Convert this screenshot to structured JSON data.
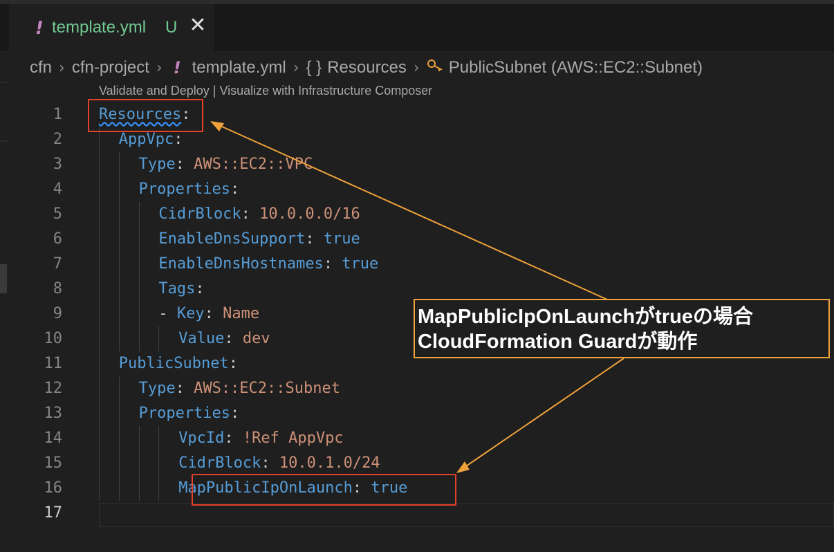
{
  "tab": {
    "icon": "yaml-exclamation-icon",
    "title": "template.yml",
    "status": "U",
    "close": "✕"
  },
  "breadcrumb": {
    "items": [
      "cfn",
      "cfn-project",
      "template.yml",
      "Resources",
      "PublicSubnet (AWS::EC2::Subnet)"
    ],
    "braces": "{ }",
    "exclamation": "!",
    "separator": "›"
  },
  "codelens": "Validate and Deploy | Visualize with Infrastructure Composer",
  "lines": [
    {
      "n": "1",
      "indent": 0,
      "key": "Resources",
      "colon": ":",
      "value": "",
      "vtype": ""
    },
    {
      "n": "2",
      "indent": 2,
      "key": "AppVpc",
      "colon": ":",
      "value": "",
      "vtype": ""
    },
    {
      "n": "3",
      "indent": 4,
      "key": "Type",
      "colon": ":",
      "value": "AWS::EC2::VPC",
      "vtype": "s"
    },
    {
      "n": "4",
      "indent": 4,
      "key": "Properties",
      "colon": ":",
      "value": "",
      "vtype": ""
    },
    {
      "n": "5",
      "indent": 6,
      "key": "CidrBlock",
      "colon": ":",
      "value": "10.0.0.0/16",
      "vtype": "s"
    },
    {
      "n": "6",
      "indent": 6,
      "key": "EnableDnsSupport",
      "colon": ":",
      "value": "true",
      "vtype": "b"
    },
    {
      "n": "7",
      "indent": 6,
      "key": "EnableDnsHostnames",
      "colon": ":",
      "value": "true",
      "vtype": "b"
    },
    {
      "n": "8",
      "indent": 6,
      "key": "Tags",
      "colon": ":",
      "value": "",
      "vtype": ""
    },
    {
      "n": "9",
      "indent": 6,
      "dash": "- ",
      "key": "Key",
      "colon": ":",
      "value": "Name",
      "vtype": "s"
    },
    {
      "n": "10",
      "indent": 8,
      "key": "Value",
      "colon": ":",
      "value": "dev",
      "vtype": "s"
    },
    {
      "n": "11",
      "indent": 2,
      "key": "PublicSubnet",
      "colon": ":",
      "value": "",
      "vtype": ""
    },
    {
      "n": "12",
      "indent": 4,
      "key": "Type",
      "colon": ":",
      "value": "AWS::EC2::Subnet",
      "vtype": "s"
    },
    {
      "n": "13",
      "indent": 4,
      "key": "Properties",
      "colon": ":",
      "value": "",
      "vtype": ""
    },
    {
      "n": "14",
      "indent": 8,
      "key": "VpcId",
      "colon": ":",
      "value": "!Ref AppVpc",
      "vtype": "s"
    },
    {
      "n": "15",
      "indent": 8,
      "key": "CidrBlock",
      "colon": ":",
      "value": "10.0.1.0/24",
      "vtype": "s"
    },
    {
      "n": "16",
      "indent": 8,
      "key": "MapPublicIpOnLaunch",
      "colon": ":",
      "value": "true",
      "vtype": "b"
    },
    {
      "n": "17",
      "indent": 0,
      "key": "",
      "colon": "",
      "value": "",
      "vtype": ""
    }
  ],
  "callout": {
    "line1": "MapPublicIpOnLaunchがtrueの場合",
    "line2": "CloudFormation Guardが動作"
  },
  "colors": {
    "highlight_box": "#e8412a",
    "callout_border": "#f0a23a",
    "key": "#569cd6",
    "string": "#ce9178"
  }
}
